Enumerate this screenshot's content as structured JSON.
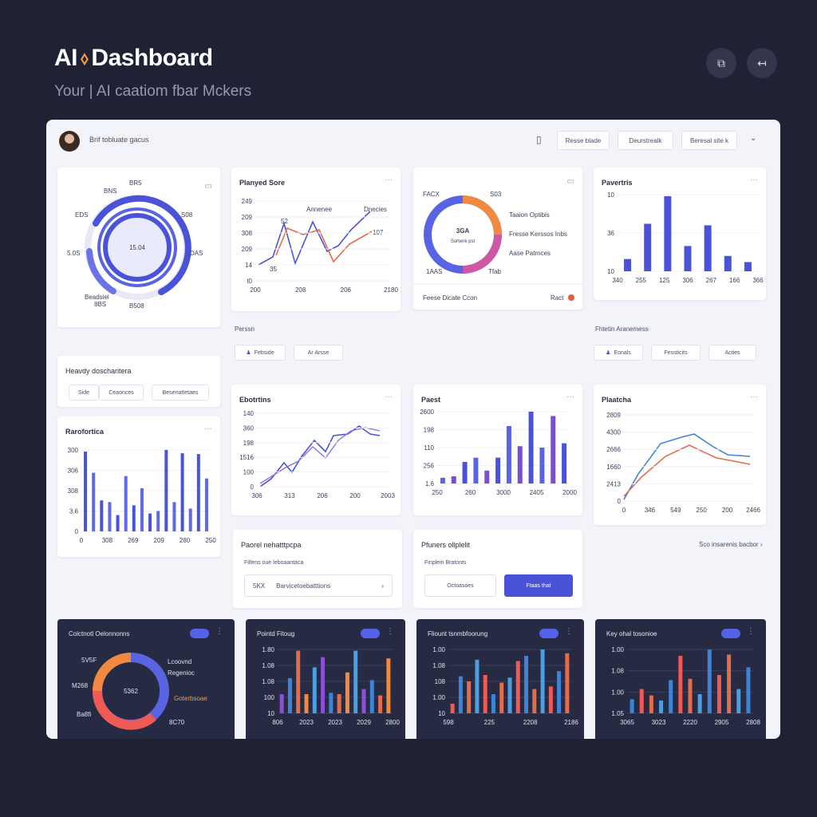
{
  "header": {
    "title": "AI",
    "title_rest": "Dashboard",
    "subtitle": "Your | AI caatiom fbar Mckers"
  },
  "panel": {
    "title": "Brif tobluate gacus",
    "buttons": [
      "Resse blade",
      "Deurstrealk",
      "Beresal site k"
    ]
  },
  "radial": {
    "center": "15.04",
    "labels": [
      "BNS",
      "EDS",
      "S08",
      "5.0S",
      "DAS",
      "Beadsiel",
      "8BS",
      "B508",
      "BR5"
    ]
  },
  "played_score": {
    "title": "Planyed Sore",
    "y_ticks": [
      "249",
      "209",
      "308",
      "209",
      "14",
      "t0"
    ],
    "x_ticks": [
      "200",
      "208",
      "206",
      "2180"
    ],
    "annotations": [
      "Annenee",
      "Dnecies",
      "52",
      "35",
      "107"
    ],
    "colors": {
      "a": "#4a53d8",
      "b": "#e36d4b"
    }
  },
  "donut1": {
    "center_top": "3GA",
    "center_bottom": "Sortenk pst",
    "labels": [
      "FACX",
      "S03",
      "1AAS",
      "Tfab"
    ],
    "legend": [
      "Taaion Optibis",
      "Fresse Kerssos Inbs",
      "Aase Patrnces"
    ],
    "footer_left": "Feese  Dicate  Ccon",
    "footer_right": "Ract"
  },
  "pavertris": {
    "title": "Pavertris",
    "y_ticks": [
      "10",
      "36",
      "10"
    ],
    "x_ticks": [
      "340",
      "255",
      "125",
      "306",
      "267",
      "166",
      "366"
    ]
  },
  "row_labels": {
    "left": "Perssn",
    "right": "Fhtetin Aranemess"
  },
  "mini_buttons": [
    "Febside",
    "Ar Arsse",
    "Eonals",
    "Fessticits",
    "Acties"
  ],
  "heavy": {
    "title": "Heavdy doscharitera",
    "buttons": [
      "Side",
      "Ceaonces",
      "Besenattetaes"
    ]
  },
  "bar_left": {
    "title": "Rarofortica",
    "y_ticks": [
      "300",
      "306",
      "308",
      "3.6",
      "0"
    ],
    "x_ticks": [
      "0",
      "308",
      "269",
      "209",
      "280",
      "250"
    ]
  },
  "line2": {
    "title": "Ebotrtins",
    "y_ticks": [
      "140",
      "360",
      "198",
      "1516",
      "100",
      "0"
    ],
    "x_ticks": [
      "306",
      "313",
      "206",
      "200",
      "2003"
    ]
  },
  "paest": {
    "title": "Paest",
    "y_ticks": [
      "2600",
      "198",
      "110",
      "256",
      "1.6"
    ],
    "x_ticks": [
      "250",
      "260",
      "3000",
      "2405",
      "2000"
    ]
  },
  "platatcha": {
    "title": "Plaatcha",
    "y_ticks": [
      "2809",
      "4300",
      "2666",
      "1660",
      "2413",
      "0"
    ],
    "x_ticks": [
      "0",
      "346",
      "549",
      "250",
      "200",
      "2466"
    ]
  },
  "input_card1": {
    "title": "Paorel nehatttpcpa",
    "sub": "Filtens oue leboaantaca",
    "field_tag": "5KX",
    "field_text": "Barvicetoebatttions"
  },
  "input_card2": {
    "title": "Pfuners ollplelit",
    "sub": "Finplein Bratonts",
    "btn_secondary": "Octoasoes",
    "btn_primary": "Ftaas that"
  },
  "link_more": "Sco insarenis bacbor",
  "dark_cards": [
    {
      "title": "Colctnotl Oelonnonns"
    },
    {
      "title": "Pointd Fitoug"
    },
    {
      "title": "Fliount tsnmbfoorung"
    },
    {
      "title": "Key ohal tosonioe"
    }
  ],
  "dark_donut": {
    "center": "5362",
    "labels": [
      "5V5F",
      "M268",
      "Ba8fi",
      "Lcoovnd",
      "Regenioc",
      "Goterbsoae",
      "8C70"
    ]
  },
  "dark_axes": {
    "a": {
      "y": [
        "1.80",
        "1.08",
        "1.08",
        "100",
        "10"
      ],
      "x": [
        "806",
        "2023",
        "2023",
        "2029",
        "2800"
      ]
    },
    "b": {
      "y": [
        "1.00",
        "1.08",
        "108",
        "1.00",
        "10"
      ],
      "x": [
        "598",
        "225",
        "2208",
        "2186"
      ]
    },
    "c": {
      "y": [
        "1.00",
        "1.08",
        "1.00",
        "1.05"
      ],
      "x": [
        "3065",
        "3023",
        "2220",
        "2905",
        "2808"
      ]
    }
  },
  "icons": [
    "spark-icon",
    "export-icon",
    "back-arrow-icon",
    "more-dots-icon",
    "chevron-down-icon",
    "chevron-right-icon"
  ]
}
